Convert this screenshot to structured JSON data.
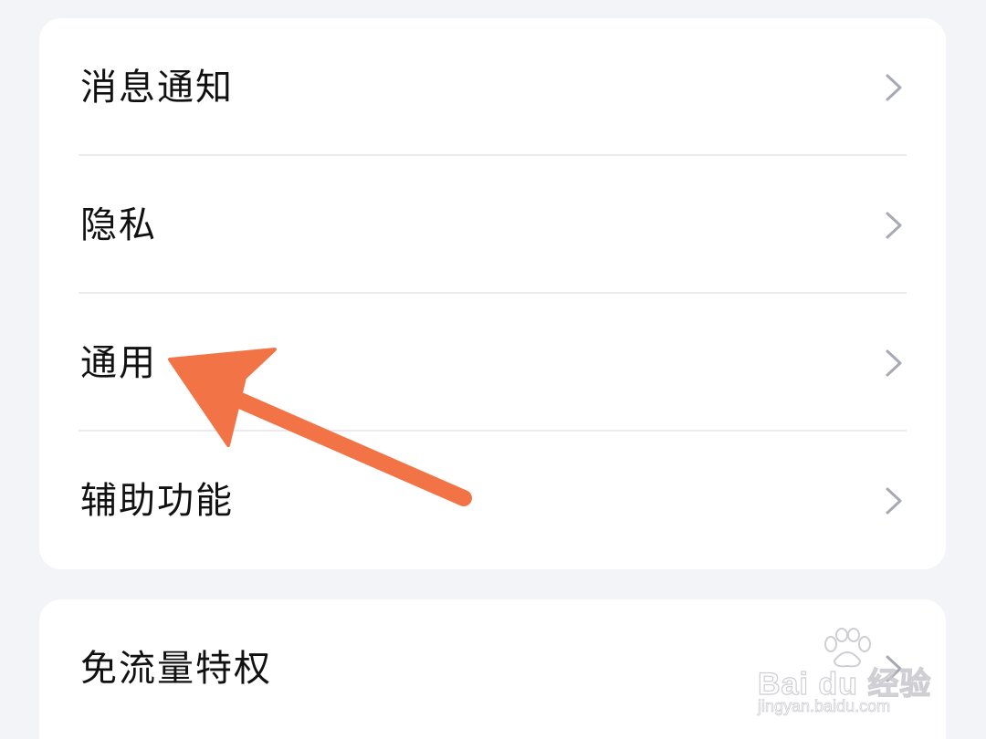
{
  "settings_group_1": {
    "items": [
      {
        "label": "消息通知"
      },
      {
        "label": "隐私"
      },
      {
        "label": "通用"
      },
      {
        "label": "辅助功能"
      }
    ]
  },
  "settings_group_2": {
    "items": [
      {
        "label": "免流量特权"
      }
    ]
  },
  "annotation": {
    "arrow_color": "#f27446",
    "target_item": "通用"
  },
  "watermark": {
    "brand": "Bai du 经验",
    "url": "jingyan.baidu.com"
  },
  "colors": {
    "background": "#f3f4f8",
    "card": "#ffffff",
    "divider": "#ebebee",
    "chevron": "#a7a9b3",
    "text": "#111111"
  },
  "icons": {
    "row_chevron": "chevron-right-icon",
    "watermark_logo": "paw-icon"
  }
}
